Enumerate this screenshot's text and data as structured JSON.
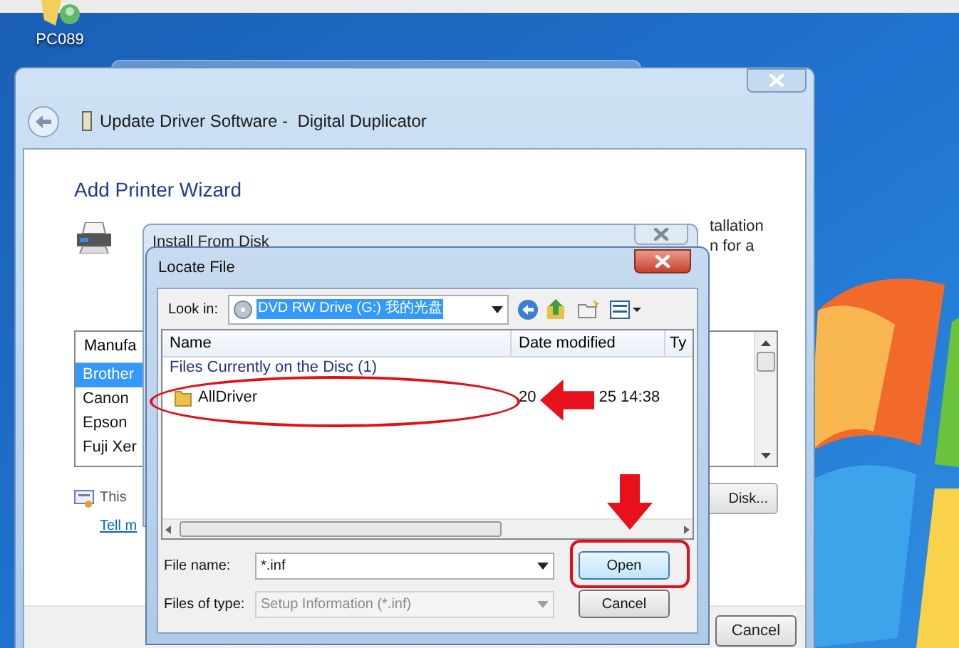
{
  "desktop": {
    "icons": [
      {
        "label": "PC089"
      }
    ]
  },
  "main_window": {
    "title": "Update Driver Software -  Digital Duplicator",
    "heading": "Add Printer Wizard",
    "instruction_fragments": [
      "tallation",
      "n for a"
    ],
    "manufacturer_list": {
      "header": "Manufa",
      "items": [
        {
          "label": "Brother",
          "selected": true
        },
        {
          "label": "Canon",
          "selected": false
        },
        {
          "label": "Epson",
          "selected": false
        },
        {
          "label": "Fuji Xer",
          "selected": false
        }
      ]
    },
    "signed_text": "This",
    "link": "Tell m",
    "have_disk_button": "Disk...",
    "cancel_button": "Cancel"
  },
  "install_from_disk": {
    "title": "Install From Disk"
  },
  "locate_file": {
    "title": "Locate File",
    "look_in_label": "Look in:",
    "look_in_value": "DVD RW Drive (G:) 我的光盘",
    "columns": [
      "Name",
      "Date modified",
      "Ty"
    ],
    "group": "Files Currently on the Disc (1)",
    "rows": [
      {
        "name": "AllDriver",
        "date_fragments": [
          "20",
          "25 14:38"
        ]
      }
    ],
    "file_name_label": "File name:",
    "file_name_value": "*.inf",
    "file_type_label": "Files of type:",
    "file_type_value": "Setup Information (*.inf)",
    "file_type_disabled": true,
    "open_button": "Open",
    "cancel_button": "Cancel"
  }
}
